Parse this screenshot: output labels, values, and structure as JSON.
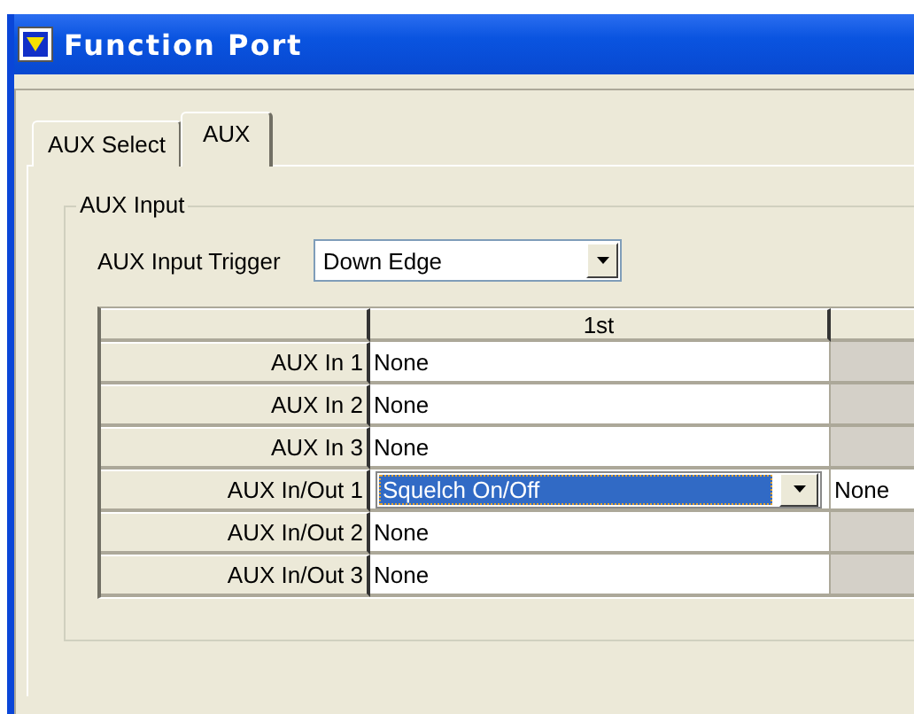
{
  "window": {
    "title": "Function Port"
  },
  "tabs": [
    {
      "label": "AUX Select",
      "selected": false
    },
    {
      "label": "AUX",
      "selected": true
    }
  ],
  "group": {
    "title": "AUX Input",
    "trigger": {
      "label": "AUX Input Trigger",
      "value": "Down Edge"
    }
  },
  "table": {
    "columns": [
      {
        "label": "1st"
      }
    ],
    "rows": [
      {
        "label": "AUX In 1",
        "cells": [
          {
            "kind": "text",
            "value": "None"
          },
          {
            "kind": "blank"
          }
        ]
      },
      {
        "label": "AUX In 2",
        "cells": [
          {
            "kind": "text",
            "value": "None"
          },
          {
            "kind": "blank"
          }
        ]
      },
      {
        "label": "AUX In 3",
        "cells": [
          {
            "kind": "text",
            "value": "None"
          },
          {
            "kind": "blank"
          }
        ]
      },
      {
        "label": "AUX In/Out 1",
        "cells": [
          {
            "kind": "combo",
            "value": "Squelch On/Off",
            "focused": true
          },
          {
            "kind": "text",
            "value": "None"
          }
        ]
      },
      {
        "label": "AUX In/Out 2",
        "cells": [
          {
            "kind": "text",
            "value": "None"
          },
          {
            "kind": "blank"
          }
        ]
      },
      {
        "label": "AUX In/Out 3",
        "cells": [
          {
            "kind": "text",
            "value": "None"
          },
          {
            "kind": "blank"
          }
        ]
      }
    ]
  }
}
